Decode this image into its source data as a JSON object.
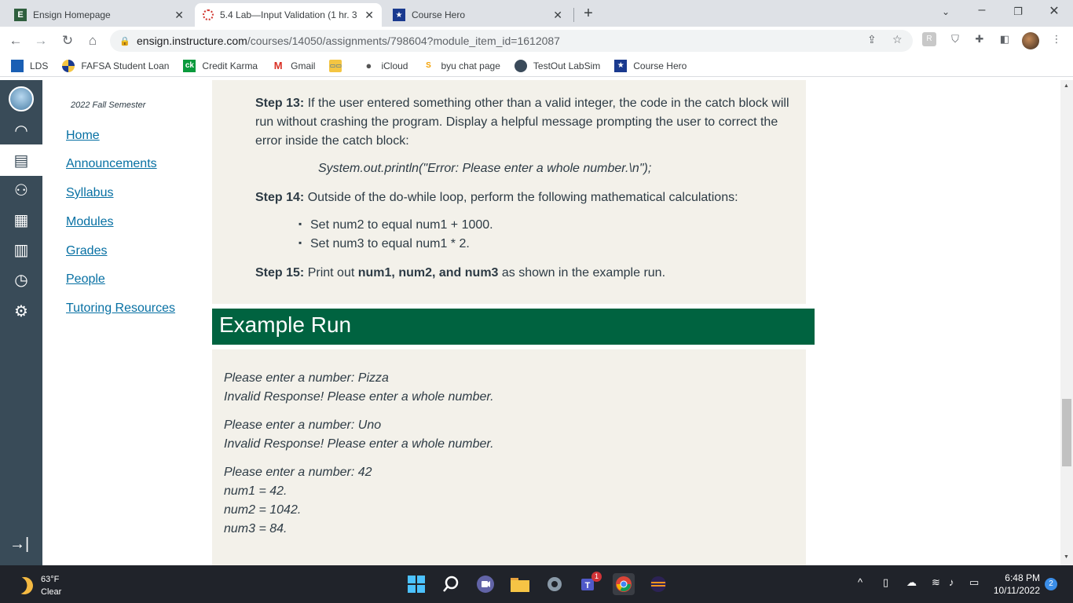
{
  "browser": {
    "tabs": [
      {
        "title": "Ensign Homepage",
        "icon": "E"
      },
      {
        "title": "5.4 Lab—Input Validation (1 hr. 3",
        "icon": ""
      },
      {
        "title": "Course Hero",
        "icon": "★"
      }
    ],
    "url_host": "ensign.instructure.com",
    "url_path": "/courses/14050/assignments/798604?module_item_id=1612087",
    "bookmarks": [
      {
        "label": "LDS",
        "icon": ""
      },
      {
        "label": "FAFSA Student Loan",
        "icon": ""
      },
      {
        "label": "Credit Karma",
        "icon": "ck"
      },
      {
        "label": "Gmail",
        "icon": "M"
      },
      {
        "label": "",
        "icon": ""
      },
      {
        "label": "iCloud",
        "icon": ""
      },
      {
        "label": "byu chat page",
        "icon": "S"
      },
      {
        "label": "TestOut LabSim",
        "icon": ""
      },
      {
        "label": "Course Hero",
        "icon": "★"
      }
    ]
  },
  "course_nav": {
    "semester": "2022 Fall Semester",
    "links": [
      "Home",
      "Announcements",
      "Syllabus",
      "Modules",
      "Grades",
      "People",
      "Tutoring Resources"
    ]
  },
  "instructions": {
    "step13_label": "Step 13:",
    "step13_line1": "If the user entered something other than a valid integer, the code in the catch block will",
    "step13_line2": "run without crashing the program. Display a helpful message prompting the user to correct the",
    "step13_line3": "error inside the catch block:",
    "code": "System.out.println(\"Error: Please enter a whole number.\\n\");",
    "step14_label": "Step 14:",
    "step14_text": "Outside of the do-while loop, perform the following mathematical calculations:",
    "bullets": [
      "Set num2 to equal num1 + 1000.",
      "Set num3 to equal num1 * 2."
    ],
    "step15_label": "Step 15:",
    "step15_pre": "Print out",
    "step15_bold": "num1, num2, and num3",
    "step15_post": "as shown in the example run."
  },
  "example_run": {
    "heading": "Example Run",
    "lines": [
      "Please enter a number: Pizza",
      "Invalid Response! Please enter a whole number.",
      "Please enter a number: Uno",
      "Invalid Response! Please enter a whole number.",
      "Please enter a number: 42",
      "num1 = 42.",
      "num2 = 1042.",
      "num3 = 84."
    ]
  },
  "taskbar": {
    "temp": "63°F",
    "condition": "Clear",
    "time": "6:48 PM",
    "date": "10/11/2022",
    "notifications": "2",
    "teams_badge": "1"
  },
  "colors": {
    "canvas_nav": "#394b58",
    "banner": "#006340",
    "panel": "#f3f1ea",
    "link": "#0770a3"
  }
}
